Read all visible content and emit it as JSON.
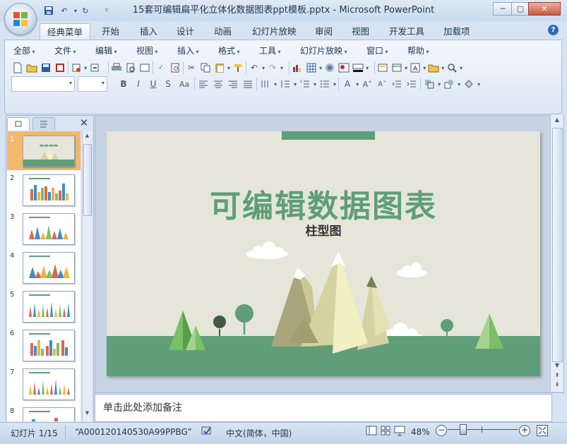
{
  "window": {
    "title": "15套可编辑扁平化立体化数据图表ppt模板.pptx - Microsoft PowerPoint"
  },
  "ribbon_tabs": [
    "经典菜单",
    "开始",
    "插入",
    "设计",
    "动画",
    "幻灯片放映",
    "审阅",
    "视图",
    "开发工具",
    "加载项"
  ],
  "classic_menus": [
    "全部",
    "文件",
    "编辑",
    "视图",
    "插入",
    "格式",
    "工具",
    "幻灯片放映",
    "窗口",
    "帮助"
  ],
  "slides_panel": {
    "thumbnails": [
      {
        "number": "1",
        "selected": true
      },
      {
        "number": "2",
        "selected": false
      },
      {
        "number": "3",
        "selected": false
      },
      {
        "number": "4",
        "selected": false
      },
      {
        "number": "5",
        "selected": false
      },
      {
        "number": "6",
        "selected": false
      },
      {
        "number": "7",
        "selected": false
      },
      {
        "number": "8",
        "selected": false
      }
    ]
  },
  "slide": {
    "title": "可编辑数据图表",
    "subtitle": "柱型图",
    "colors": {
      "background": "#e5e6d9",
      "accent": "#5f9e79",
      "ground": "#5f9e79",
      "mountain_light": "#f2efc4",
      "mountain_mid": "#d3d3a2",
      "mountain_dark": "#a6a57b"
    }
  },
  "notes": {
    "placeholder": "单击此处添加备注"
  },
  "status_bar": {
    "slide_indicator": "幻灯片 1/15",
    "theme_name": "“A000120140530A99PPBG”",
    "language": "中文(简体，中国)",
    "zoom": "48%"
  }
}
